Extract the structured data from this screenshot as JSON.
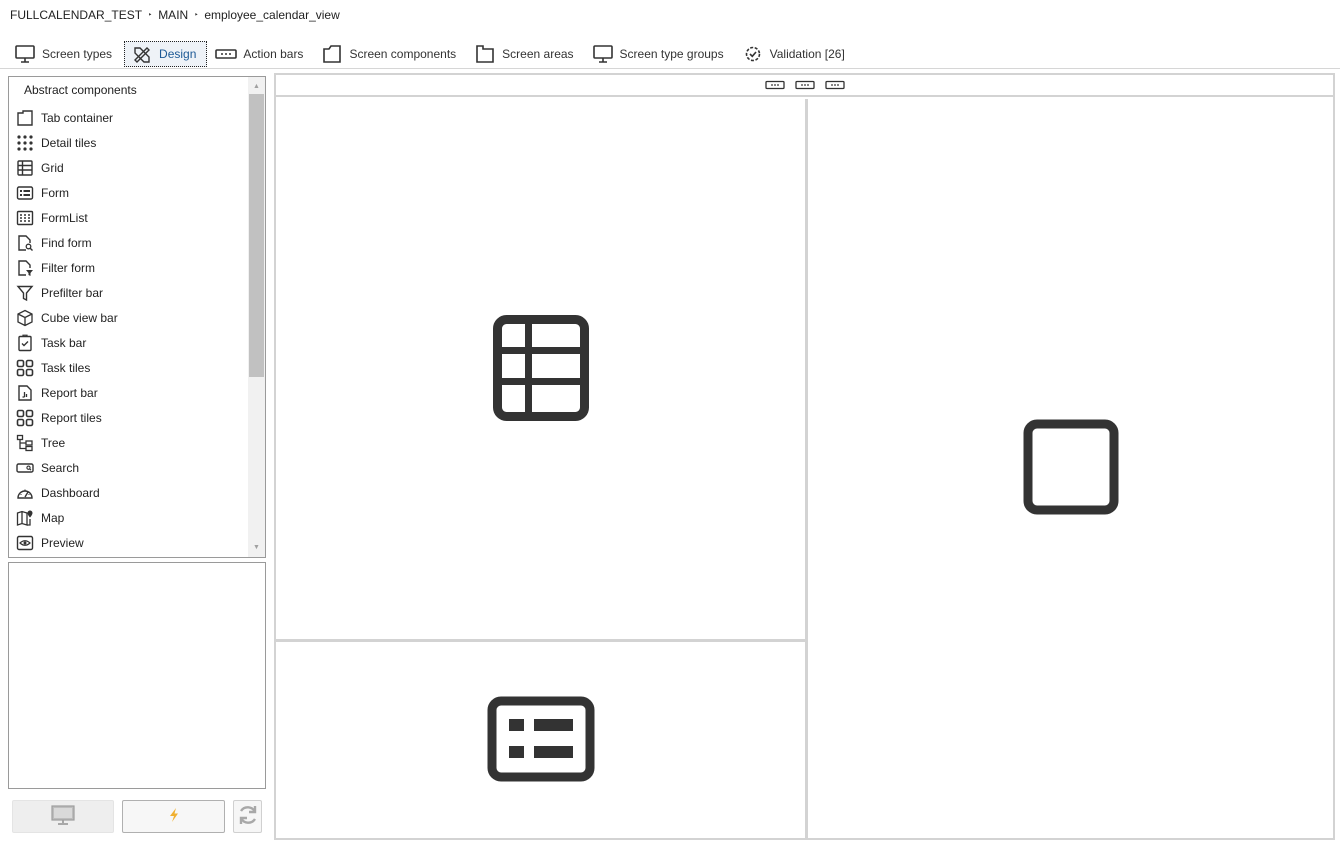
{
  "breadcrumb": {
    "items": [
      "FULLCALENDAR_TEST",
      "MAIN",
      "employee_calendar_view"
    ],
    "separator": "‣"
  },
  "tabs": [
    {
      "label": "Screen types",
      "icon": "monitor-icon"
    },
    {
      "label": "Design",
      "icon": "design-tools-icon",
      "active": true
    },
    {
      "label": "Action bars",
      "icon": "action-bar-icon"
    },
    {
      "label": "Screen components",
      "icon": "screen-component-icon"
    },
    {
      "label": "Screen areas",
      "icon": "screen-area-icon"
    },
    {
      "label": "Screen type groups",
      "icon": "monitor-icon"
    },
    {
      "label": "Validation [26]",
      "icon": "validation-gear-icon"
    }
  ],
  "left_panel": {
    "title": "Abstract components",
    "items": [
      {
        "label": "Tab container",
        "icon": "tab-container-icon"
      },
      {
        "label": "Detail tiles",
        "icon": "detail-tiles-icon"
      },
      {
        "label": "Grid",
        "icon": "grid-icon"
      },
      {
        "label": "Form",
        "icon": "form-icon"
      },
      {
        "label": "FormList",
        "icon": "formlist-icon"
      },
      {
        "label": "Find form",
        "icon": "find-form-icon"
      },
      {
        "label": "Filter form",
        "icon": "filter-form-icon"
      },
      {
        "label": "Prefilter bar",
        "icon": "funnel-icon"
      },
      {
        "label": "Cube view bar",
        "icon": "cube-icon"
      },
      {
        "label": "Task bar",
        "icon": "task-bar-icon"
      },
      {
        "label": "Task tiles",
        "icon": "task-tiles-icon"
      },
      {
        "label": "Report bar",
        "icon": "report-bar-icon"
      },
      {
        "label": "Report tiles",
        "icon": "report-tiles-icon"
      },
      {
        "label": "Tree",
        "icon": "tree-icon"
      },
      {
        "label": "Search",
        "icon": "search-box-icon"
      },
      {
        "label": "Dashboard",
        "icon": "dashboard-icon"
      },
      {
        "label": "Map",
        "icon": "map-icon"
      },
      {
        "label": "Preview",
        "icon": "preview-icon"
      }
    ]
  },
  "bottom_buttons": [
    {
      "name": "preview-screen-button",
      "icon": "monitor-icon"
    },
    {
      "name": "generate-button",
      "icon": "lightning-icon"
    },
    {
      "name": "refresh-button",
      "icon": "refresh-icon"
    }
  ],
  "design": {
    "action_bar_icons": 3,
    "areas": [
      {
        "name": "grid-area",
        "icon": "grid-icon"
      },
      {
        "name": "form-area",
        "icon": "form-icon"
      },
      {
        "name": "empty-area",
        "icon": "empty-square-icon"
      }
    ]
  },
  "colors": {
    "active_tab_text": "#1e5a96",
    "border": "#d3d3d3",
    "icon_dark": "#333333",
    "lightning": "#f0b030"
  }
}
